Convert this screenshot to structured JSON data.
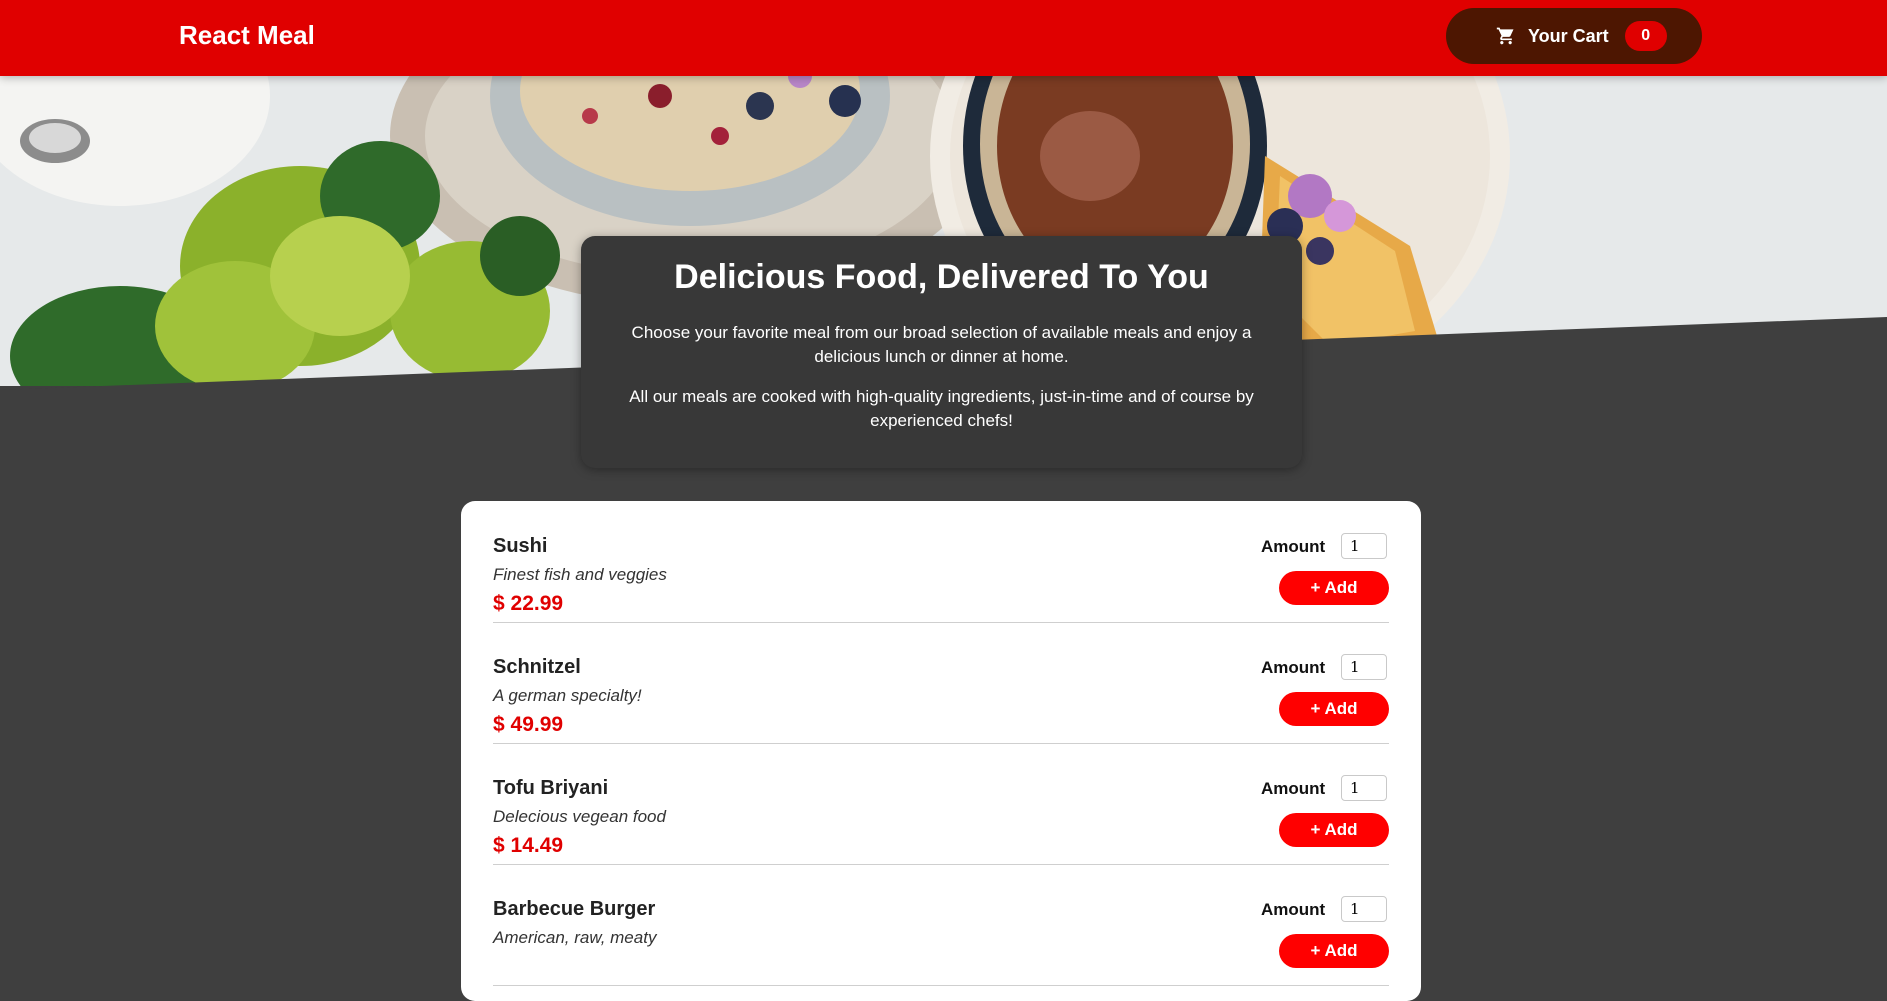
{
  "header": {
    "brand": "React Meal",
    "cart": {
      "label": "Your Cart",
      "count": "0",
      "icon": "cart-icon"
    }
  },
  "summary": {
    "title": "Delicious Food, Delivered To You",
    "paragraphs": [
      "Choose your favorite meal from our broad selection of available meals and enjoy a delicious lunch or dinner at home.",
      "All our meals are cooked with high-quality ingredients, just-in-time and of course by experienced chefs!"
    ]
  },
  "meals": [
    {
      "name": "Sushi",
      "description": "Finest fish and veggies",
      "price": "$ 22.99",
      "amount_label": "Amount",
      "amount": "1",
      "add_label": "+ Add"
    },
    {
      "name": "Schnitzel",
      "description": "A german specialty!",
      "price": "$ 49.99",
      "amount_label": "Amount",
      "amount": "1",
      "add_label": "+ Add"
    },
    {
      "name": "Tofu Briyani",
      "description": "Delecious vegean food",
      "price": "$ 14.49",
      "amount_label": "Amount",
      "amount": "1",
      "add_label": "+ Add"
    },
    {
      "name": "Barbecue Burger",
      "description": "American, raw, meaty",
      "price": "",
      "amount_label": "Amount",
      "amount": "1",
      "add_label": "+ Add"
    }
  ],
  "colors": {
    "header": "#e00000",
    "cart_button": "#4d1601",
    "price": "#e00000",
    "add_button": "#ff0000",
    "background": "#3f3f3f"
  }
}
